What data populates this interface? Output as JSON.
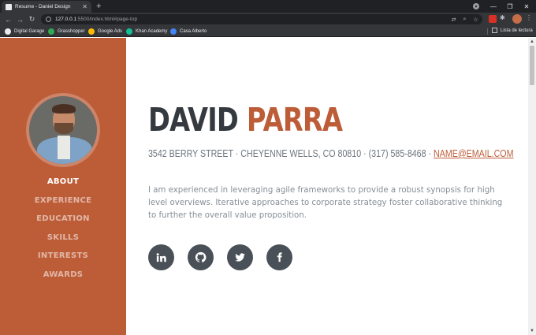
{
  "browser": {
    "tab_title": "Resume - Daniel Design",
    "url_host": "127.0.0.1",
    "url_rest": ":5500/index.html#page-top",
    "bookmarks": [
      {
        "label": "Digital Garage",
        "color": "#e8eaed"
      },
      {
        "label": "Grasshopper",
        "color": "#34a853"
      },
      {
        "label": "Google Ads",
        "color": "#fbbc04"
      },
      {
        "label": "Khan Academy",
        "color": "#14bf96"
      },
      {
        "label": "Casa Alberto",
        "color": "#4285f4"
      }
    ],
    "reading_list": "Lista de lectura"
  },
  "sidebar": {
    "nav": [
      {
        "label": "ABOUT",
        "active": true
      },
      {
        "label": "EXPERIENCE",
        "active": false
      },
      {
        "label": "EDUCATION",
        "active": false
      },
      {
        "label": "SKILLS",
        "active": false
      },
      {
        "label": "INTERESTS",
        "active": false
      },
      {
        "label": "AWARDS",
        "active": false
      }
    ]
  },
  "profile": {
    "first_name": "DAVID",
    "last_name": "PARRA",
    "address": "3542 BERRY STREET · CHEYENNE WELLS, CO 80810 · (317) 585-8468 · ",
    "email": "NAME@EMAIL.COM",
    "bio": "I am experienced in leveraging agile frameworks to provide a robust synopsis for high level overviews. Iterative approaches to corporate strategy foster collaborative thinking to further the overall value proposition."
  },
  "socials": [
    {
      "icon": "linkedin-icon"
    },
    {
      "icon": "github-icon"
    },
    {
      "icon": "twitter-icon"
    },
    {
      "icon": "facebook-icon"
    }
  ],
  "colors": {
    "accent": "#bd5d38",
    "heading": "#343a40",
    "social_bg": "#495057"
  }
}
